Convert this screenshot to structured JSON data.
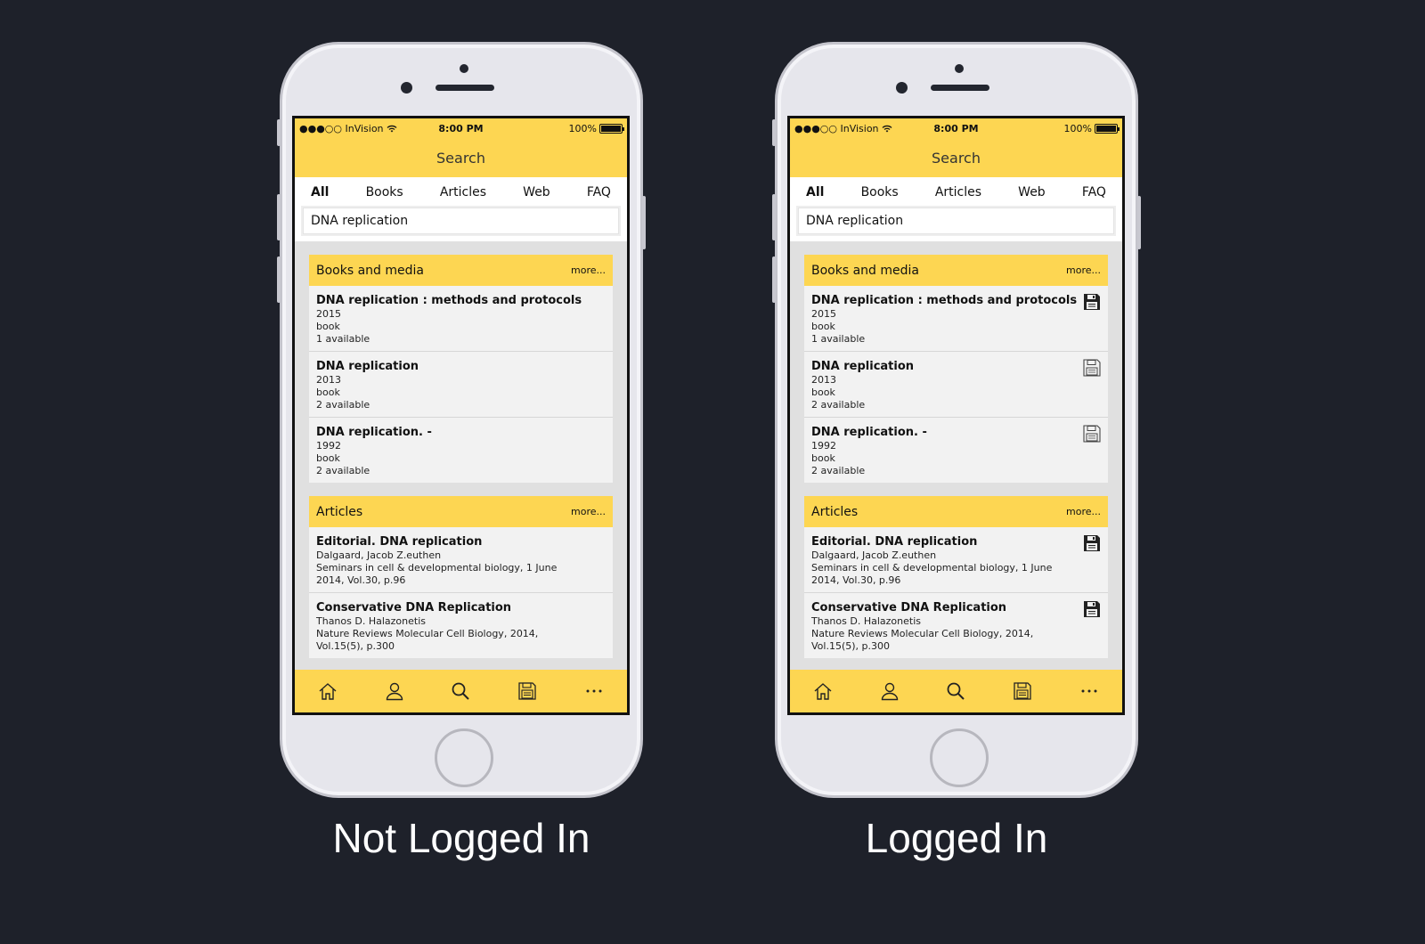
{
  "colors": {
    "background": "#1e212a",
    "accent": "#fdd652",
    "card": "#f2f2f2"
  },
  "status_bar": {
    "carrier": "●●●○○ InVision",
    "time": "8:00 PM",
    "battery": "100%"
  },
  "nav": {
    "title": "Search"
  },
  "tabs": [
    "All",
    "Books",
    "Articles",
    "Web",
    "FAQ"
  ],
  "search": {
    "value": "DNA replication"
  },
  "books": {
    "title": "Books and media",
    "more": "more...",
    "items": [
      {
        "title": "DNA replication : methods and protocols",
        "lines": [
          "2015",
          "book",
          "1 available"
        ]
      },
      {
        "title": "DNA replication",
        "lines": [
          "2013",
          "book",
          "2 available"
        ]
      },
      {
        "title": "DNA replication. -",
        "lines": [
          "1992",
          "book",
          "2 available"
        ]
      }
    ]
  },
  "articles": {
    "title": "Articles",
    "more": "more...",
    "items": [
      {
        "title": "Editorial. DNA replication",
        "lines": [
          "Dalgaard, Jacob Z.euthen",
          "Seminars in cell & developmental biology, 1 June",
          "2014, Vol.30, p.96"
        ]
      },
      {
        "title": "Conservative DNA Replication",
        "lines": [
          "Thanos D. Halazonetis",
          "Nature Reviews Molecular Cell Biology, 2014,",
          "Vol.15(5), p.300"
        ]
      }
    ]
  },
  "tabbar_icons": [
    "home-icon",
    "profile-icon",
    "search-icon",
    "saved-icon",
    "more-icon"
  ],
  "saved_state_logged_in": {
    "books": [
      "saved",
      "unsaved",
      "unsaved"
    ],
    "articles": [
      "saved",
      "saved"
    ]
  },
  "captions": {
    "left": "Not Logged In",
    "right": "Logged In"
  }
}
